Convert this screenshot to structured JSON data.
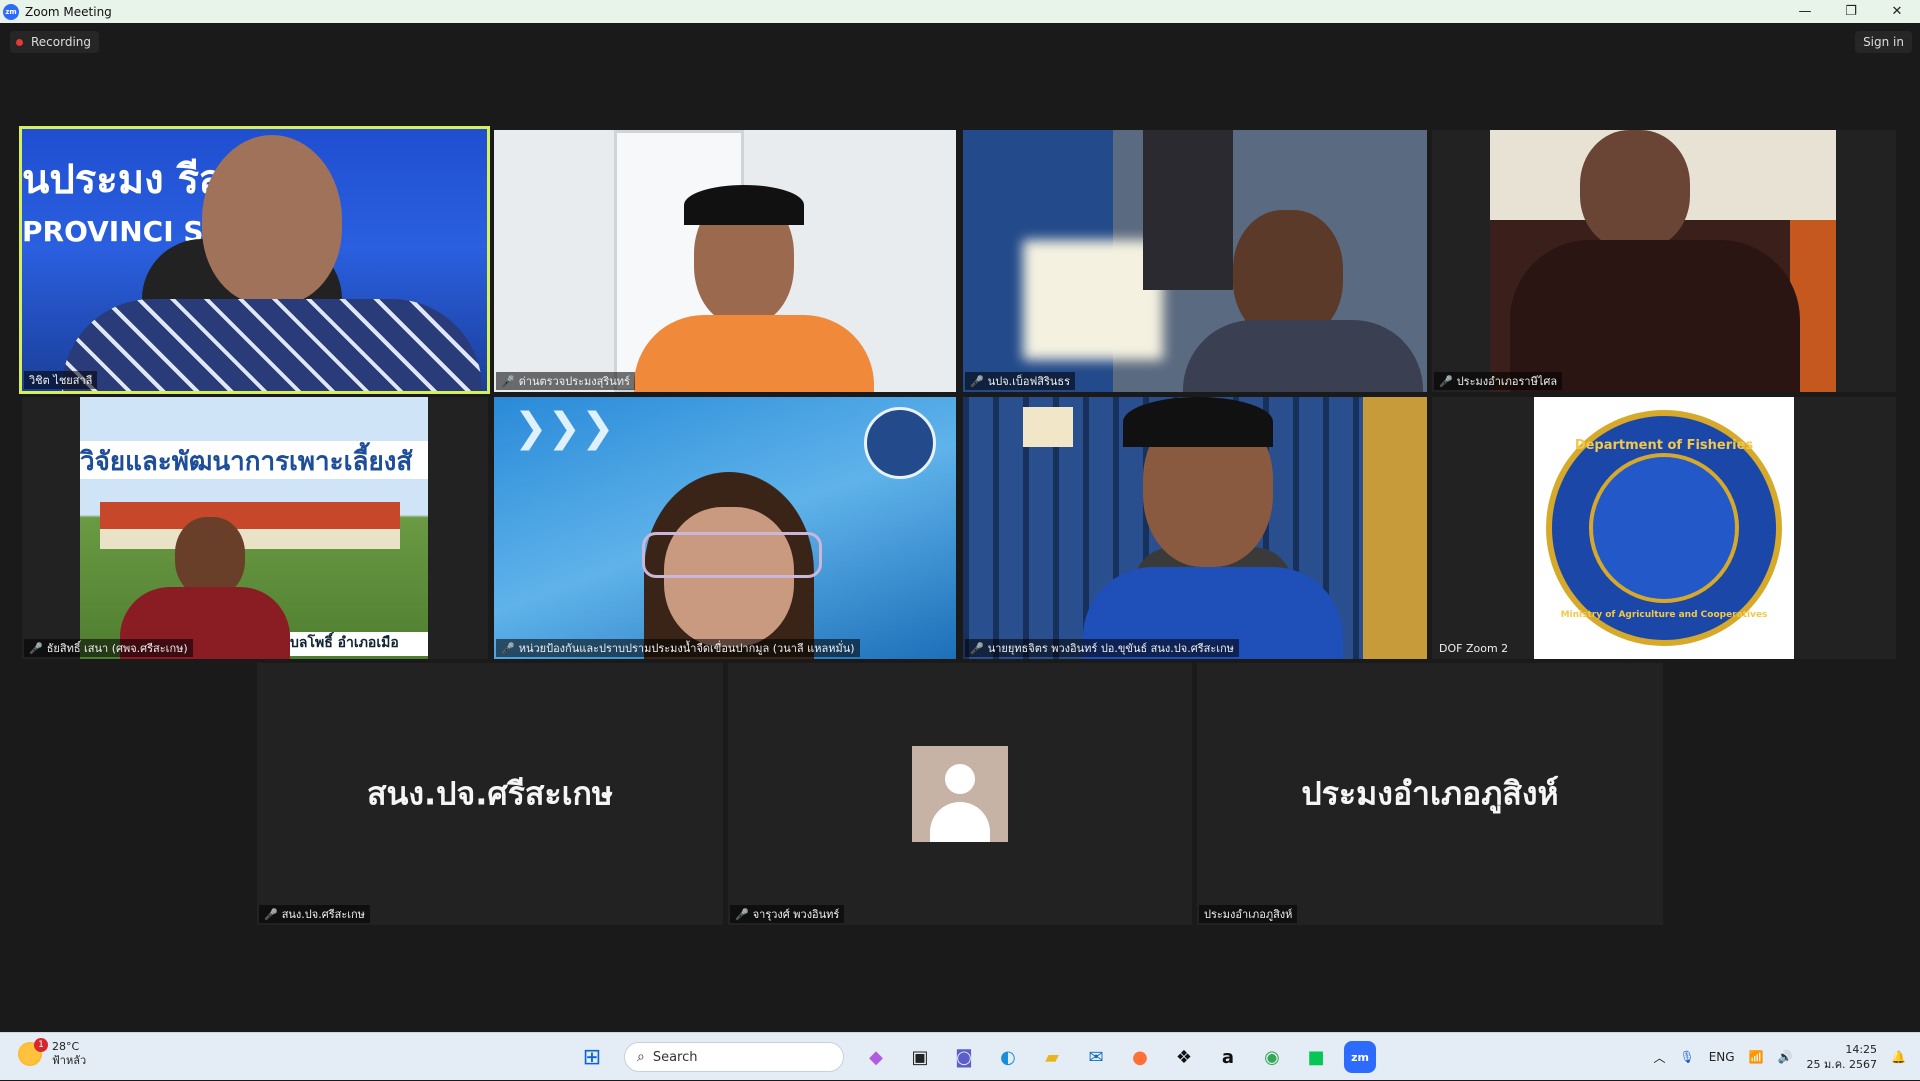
{
  "window": {
    "title": "Zoom Meeting",
    "logo_text": "zm"
  },
  "controls": {
    "minimize": "—",
    "restore": "❐",
    "close": "✕"
  },
  "topbar": {
    "recording_label": "Recording",
    "signin_label": "Sign in"
  },
  "tiles": [
    {
      "name": "วิชิต ไชยสาลี",
      "muted": false,
      "active": true
    },
    {
      "name": "ด่านตรวจประมงสุรินทร์",
      "muted": true
    },
    {
      "name": "นปจ.เบ็อฟสิรินธร",
      "muted": true
    },
    {
      "name": "ประมงอำเภอราษีไศล",
      "muted": true
    },
    {
      "name": "ธัยสิทธิ์ เสนา (ศพจ.ศรีสะเกษ)",
      "muted": true
    },
    {
      "name": "หน่วยป้องกันและปราบปรามประมงน้ำจืดเขื่อนปากมูล (วนาลี แหลหมั่น)",
      "muted": true
    },
    {
      "name": "นายยุทธจิตร พวงอินทร์ ปอ.ขุขันธ์ สนง.ปจ.ศรีสะเกษ",
      "muted": true
    },
    {
      "name": "DOF Zoom 2",
      "muted": false
    },
    {
      "name": "สนง.ปจ.ศรีสะเกษ",
      "muted": true,
      "display_text": "สนง.ปจ.ศรีสะเกษ"
    },
    {
      "name": "จารุวงศ์ พวงอินทร์",
      "muted": true
    },
    {
      "name": "ประมงอำเภอภูสิงห์",
      "muted": false,
      "display_text": "ประมงอำเภอภูสิงห์"
    }
  ],
  "video_text": {
    "t1_line1": "นประมง   รีสะเก",
    "t1_line2": "PROVINCI      S OFFI",
    "t5_banner": "วิจัยและพัฒนาการเพาะเลี้ยงสั",
    "t5_bottom": "บลโพธิ์ อำเภอเมือ",
    "dof_top": "Department of Fisheries",
    "dof_bottom": "Ministry of Agriculture and Cooperatives"
  },
  "taskbar": {
    "temperature": "28°C",
    "weather_desc": "ฟ้าหลัว",
    "weather_badge": "1",
    "search_placeholder": "Search",
    "language": "ENG",
    "time": "14:25",
    "date": "25 ม.ค. 2567"
  },
  "colors": {
    "active_speaker_border": "#d6f05a",
    "mute_icon": "#e53935",
    "recording_dot": "#e53935"
  }
}
